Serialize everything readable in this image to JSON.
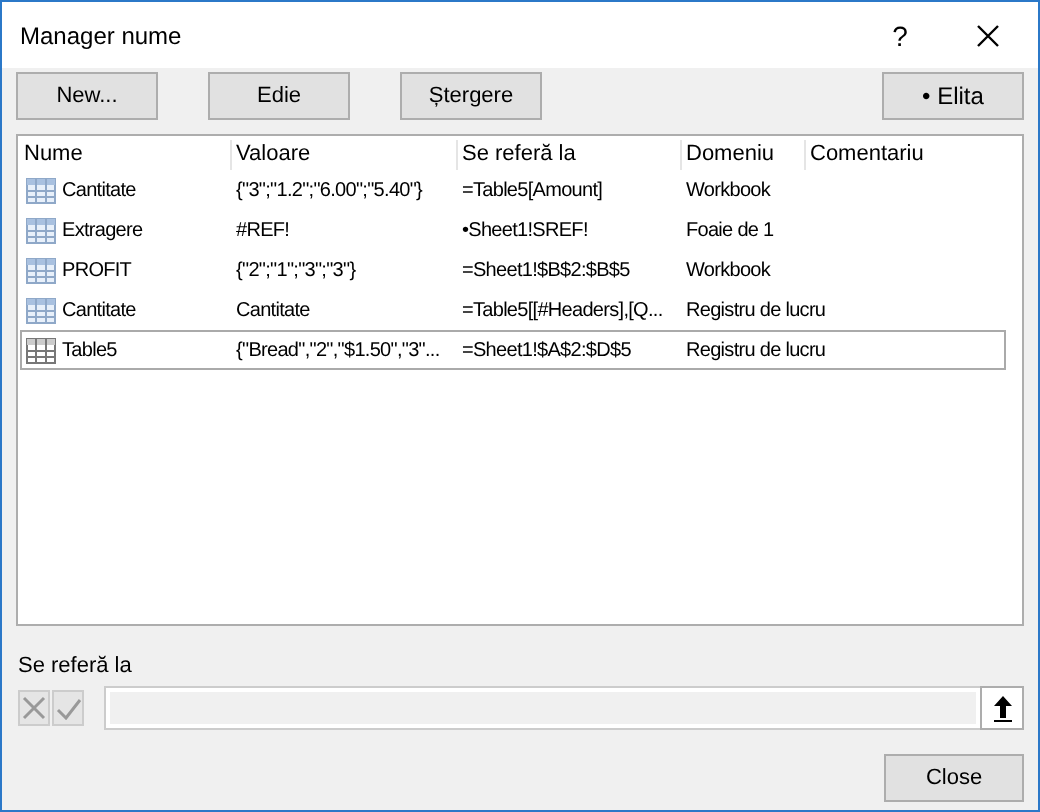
{
  "window": {
    "title": "Manager nume",
    "help": "?"
  },
  "buttons": [
    {
      "label": "New...",
      "kind": "left"
    },
    {
      "label": "Edie",
      "kind": "left"
    },
    {
      "label": "Ștergere",
      "kind": "left"
    },
    {
      "label": "• Elita",
      "kind": "right"
    }
  ],
  "table": {
    "columns": [
      "Nume",
      "Valoare",
      "Se referă la",
      "Domeniu",
      "Comentariu"
    ],
    "rows": [
      {
        "cells": [
          "Cantitate",
          "{\"3\";\"1.2\";\"6.00\";\"5.40\"}",
          "=Table5[Amount]",
          "Workbook"
        ],
        "selected": false
      },
      {
        "cells": [
          "Extragere",
          "#REF!",
          "•Sheet1!SREF!",
          "Foaie de 1"
        ],
        "selected": false
      },
      {
        "cells": [
          "PROFIT",
          "{\"2\";\"1\";\"3\";\"3\"}",
          "=Sheet1!$B$2:$B$5",
          "Workbook"
        ],
        "selected": false
      },
      {
        "cells": [
          "Cantitate",
          "Cantitate",
          "=Table5[[#Headers],[Q...",
          "Registru de lucru"
        ],
        "selected": false
      },
      {
        "cells": [
          "Table5",
          "{\"Bread\",\"2\",\"$1.50\",\"3\"...",
          "=Sheet1!$A$2:$D$5",
          "Registru de lucru"
        ],
        "selected": true
      }
    ]
  },
  "refers_to": {
    "label": "Se referă la",
    "cancel_disabled": true,
    "confirm_disabled": true
  },
  "close": "Close"
}
